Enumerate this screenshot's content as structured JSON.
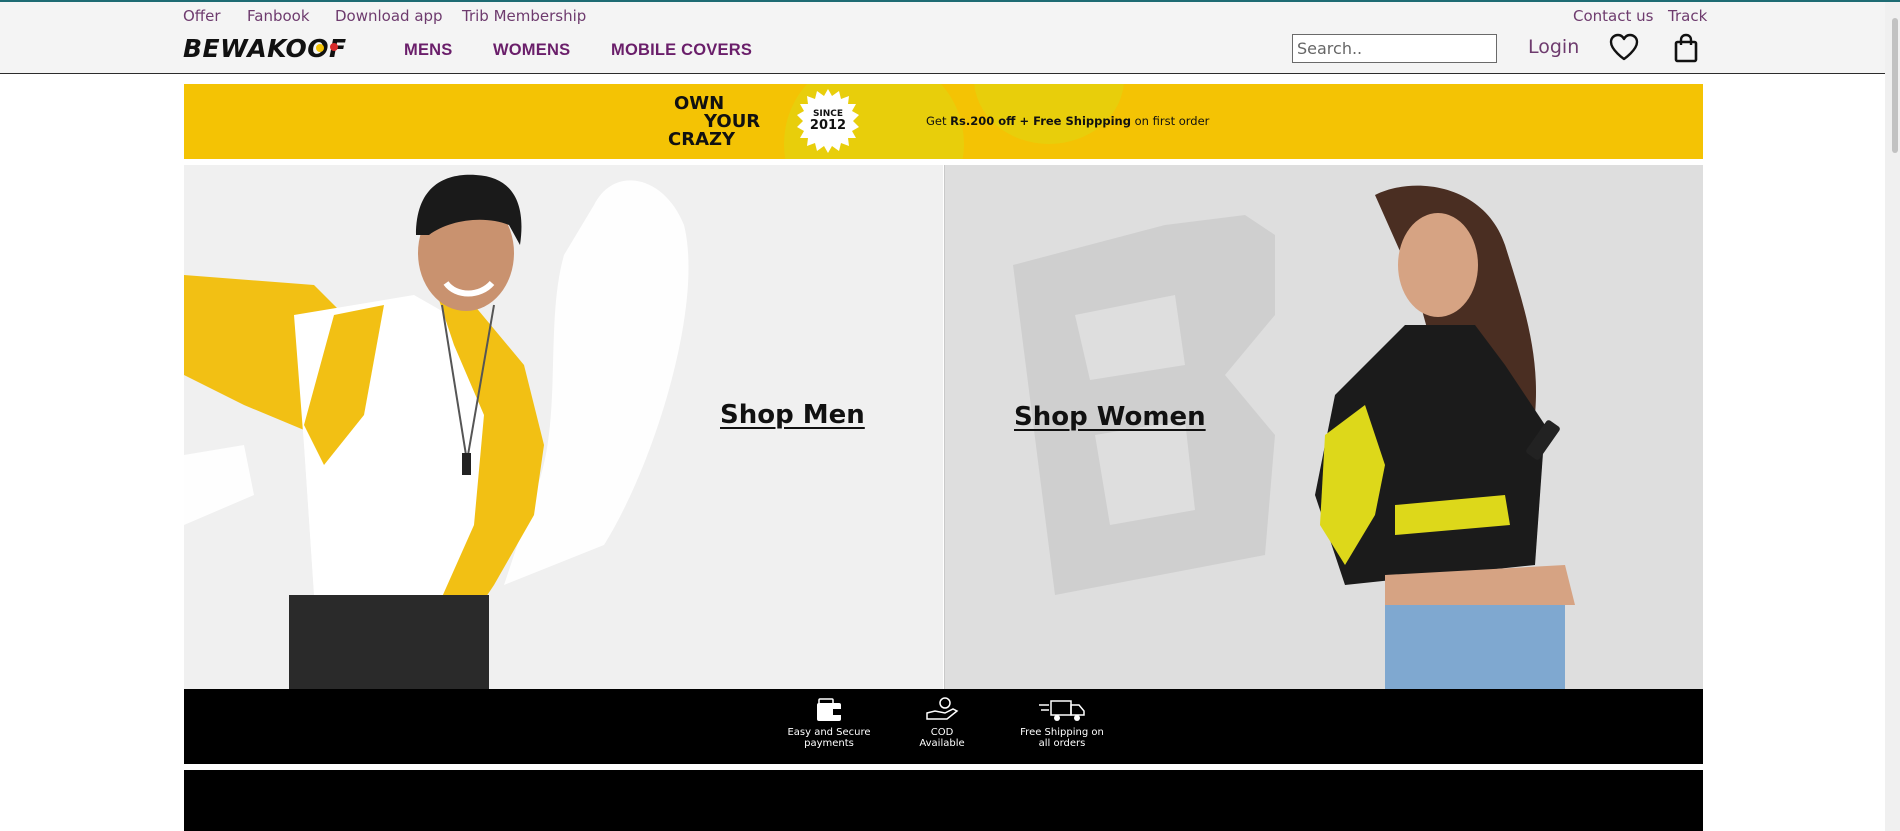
{
  "top_links": {
    "offer": "Offer",
    "fanbook": "Fanbook",
    "download_app": "Download app",
    "trib_membership": "Trib Membership",
    "contact_us": "Contact us",
    "track": "Track"
  },
  "brand": {
    "logo_text": "BEWAKOOF"
  },
  "nav": {
    "mens": "MENS",
    "womens": "WOMENS",
    "mobile_covers": "MOBILE COVERS"
  },
  "search": {
    "placeholder": "Search.."
  },
  "account": {
    "login": "Login"
  },
  "promo": {
    "line1": "OWN",
    "line2": "YOUR",
    "line3": "CRAZY",
    "since_label": "SINCE",
    "since_year": "2012",
    "offer_prefix": "Get",
    "offer_bold": "Rs.200 off + Free Shippping",
    "offer_suffix": "on first order"
  },
  "hero": {
    "men_cta": "Shop Men",
    "women_cta": "Shop Women"
  },
  "features": [
    {
      "icon": "wallet-icon",
      "label": "Easy and Secure\npayments"
    },
    {
      "icon": "cash-hand-icon",
      "label": "COD\nAvailable"
    },
    {
      "icon": "delivery-truck-icon",
      "label": "Free Shipping on\nall orders"
    }
  ],
  "colors": {
    "accent_purple": "#6a1e6a",
    "promo_yellow": "#f4c304",
    "features_bg": "#000000",
    "header_bg": "#f4f4f4"
  }
}
